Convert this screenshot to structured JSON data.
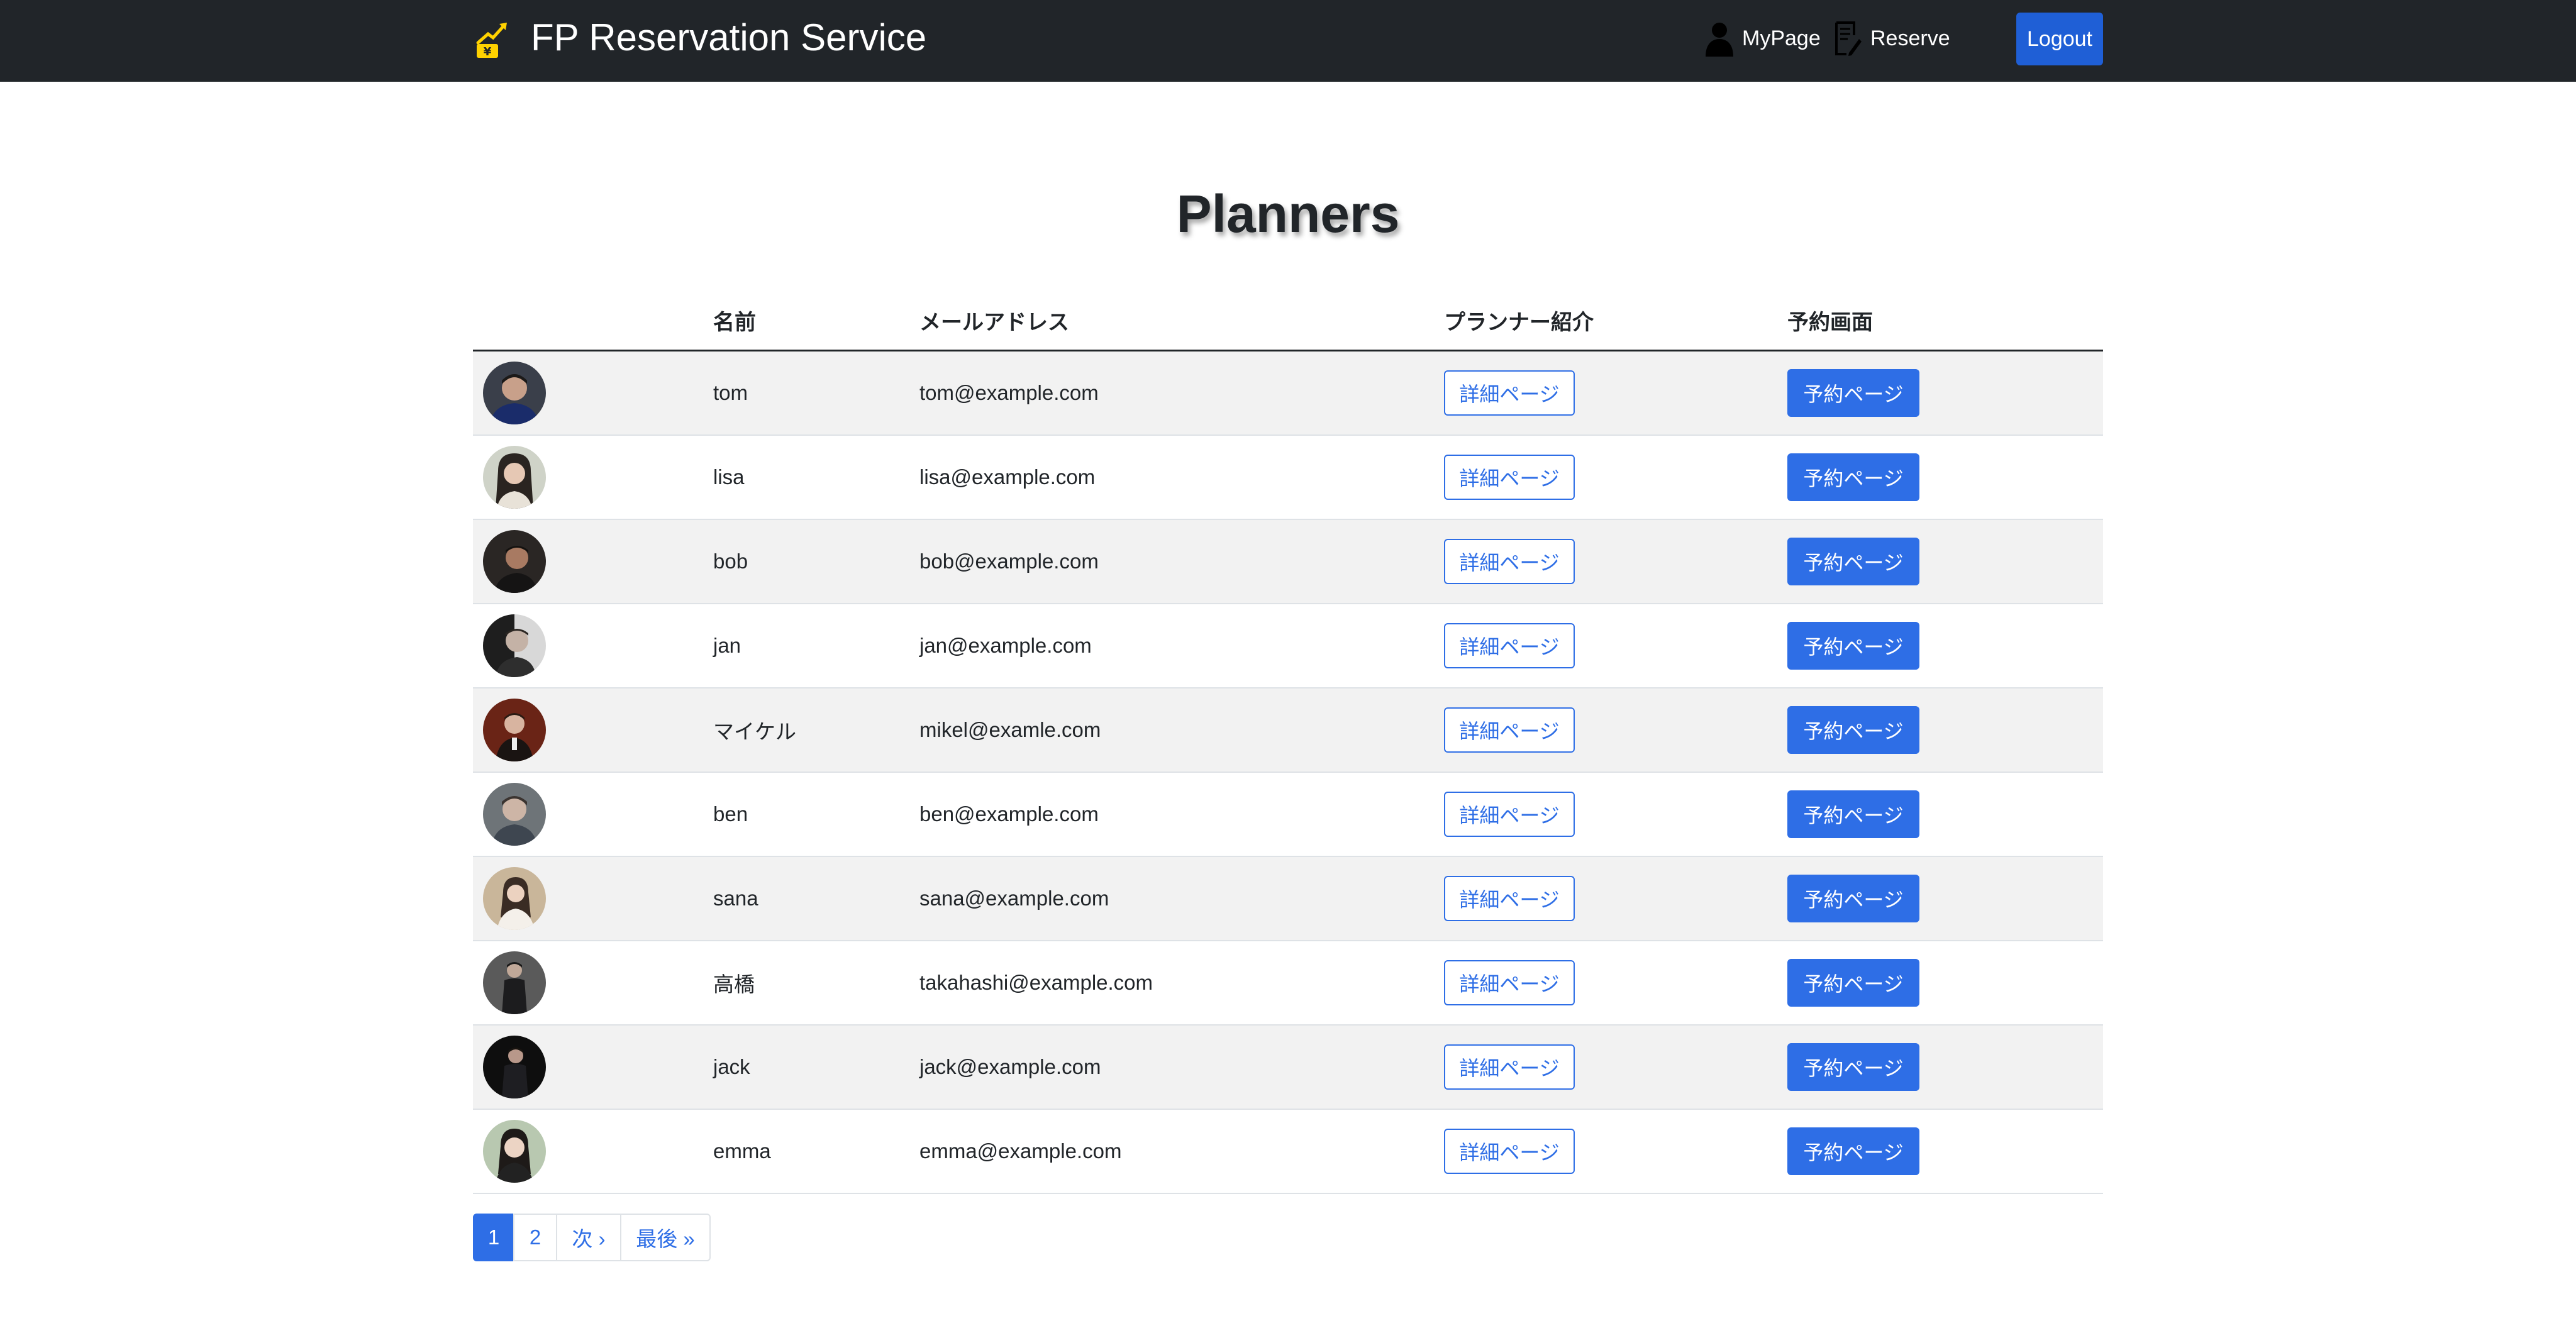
{
  "navbar": {
    "brand": "FP Reservation Service",
    "brand_icon": "yen-growth-icon",
    "mypage_label": "MyPage",
    "reserve_label": "Reserve",
    "logout_label": "Logout"
  },
  "page_title": "Planners",
  "table": {
    "headers": {
      "avatar": "",
      "name": "名前",
      "email": "メールアドレス",
      "intro": "プランナー紹介",
      "reserve": "予約画面"
    },
    "detail_label": "詳細ページ",
    "reserve_label": "予約ページ",
    "rows": [
      {
        "name": "tom",
        "email": "tom@example.com"
      },
      {
        "name": "lisa",
        "email": "lisa@example.com"
      },
      {
        "name": "bob",
        "email": "bob@example.com"
      },
      {
        "name": "jan",
        "email": "jan@example.com"
      },
      {
        "name": "マイケル",
        "email": "mikel@examle.com"
      },
      {
        "name": "ben",
        "email": "ben@example.com"
      },
      {
        "name": "sana",
        "email": "sana@example.com"
      },
      {
        "name": "高橋",
        "email": "takahashi@example.com"
      },
      {
        "name": "jack",
        "email": "jack@example.com"
      },
      {
        "name": "emma",
        "email": "emma@example.com"
      }
    ]
  },
  "pagination": {
    "pages": [
      "1",
      "2"
    ],
    "active": "1",
    "next_label": "次 ›",
    "last_label": "最後 »"
  },
  "colors": {
    "navbar_bg": "#212529",
    "primary": "#2e6ee6",
    "logout_bg": "#1f5fd6",
    "stripe": "#f2f2f2"
  }
}
